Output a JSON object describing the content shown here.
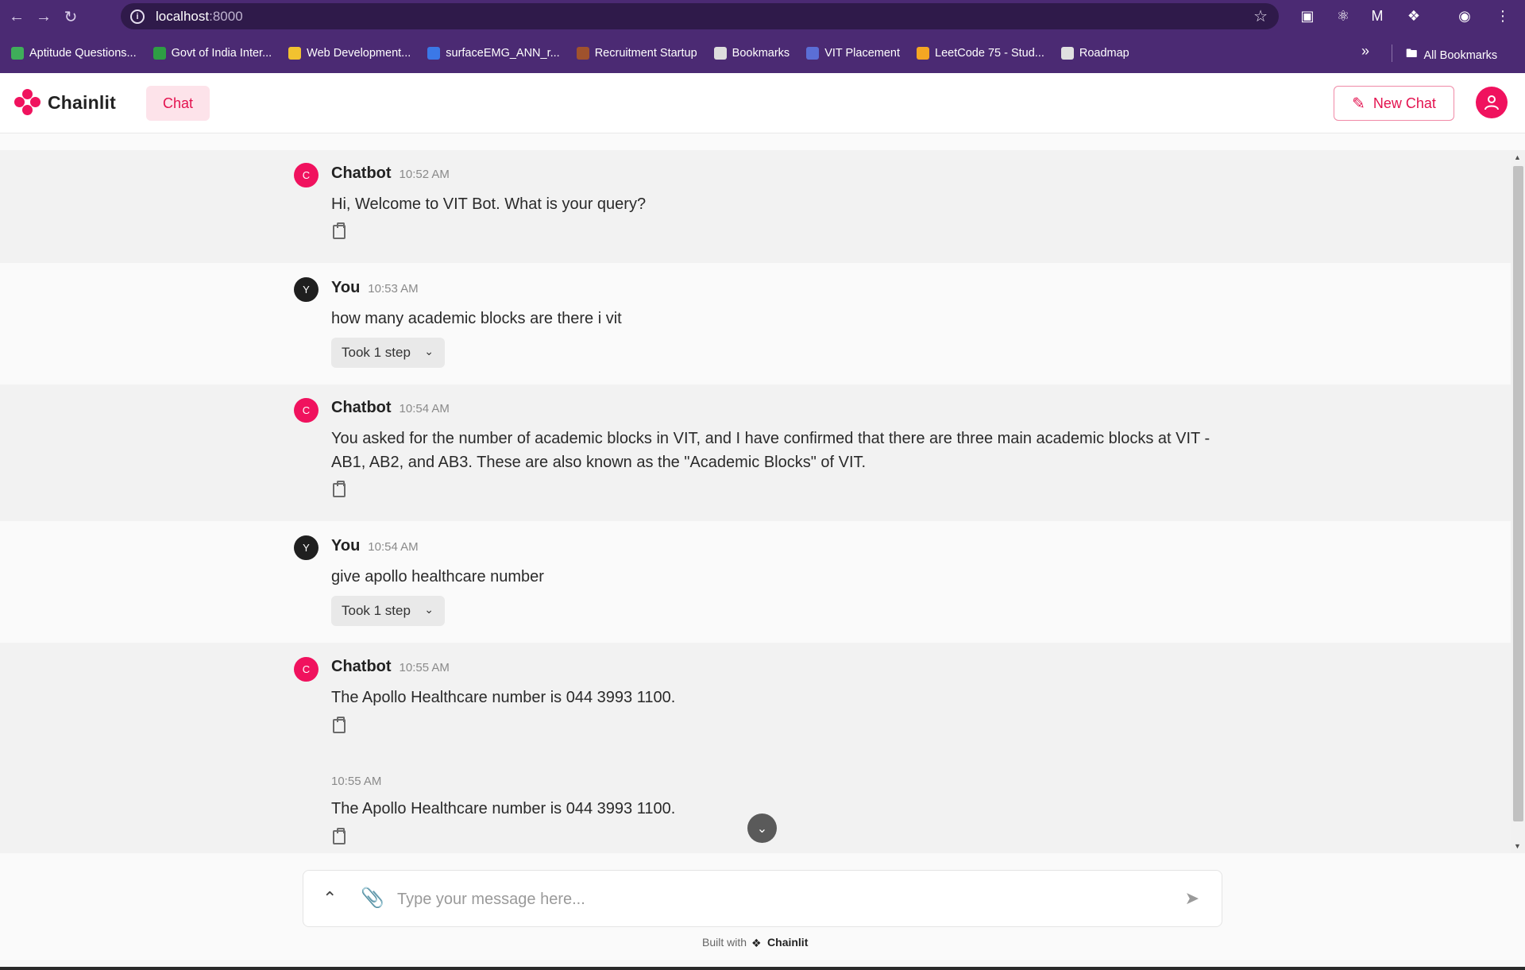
{
  "browser": {
    "url_host": "localhost",
    "url_port": ":8000",
    "bookmarks": [
      {
        "label": "Aptitude Questions...",
        "color": "#3fae5a"
      },
      {
        "label": "Govt of India Inter...",
        "color": "#2e9e44"
      },
      {
        "label": "Web Development...",
        "color": "#f2c230"
      },
      {
        "label": "surfaceEMG_ANN_r...",
        "color": "#3b78e7"
      },
      {
        "label": "Recruitment Startup",
        "color": "#a0522d"
      },
      {
        "label": "Bookmarks",
        "color": "#dddddd"
      },
      {
        "label": "VIT Placement",
        "color": "#5b6ed6"
      },
      {
        "label": "LeetCode 75 - Stud...",
        "color": "#f5a623"
      },
      {
        "label": "Roadmap",
        "color": "#e0e0e0"
      }
    ],
    "all_bookmarks": "All Bookmarks"
  },
  "app": {
    "brand": "Chainlit",
    "chat_tab": "Chat",
    "new_chat": "New Chat",
    "accent": "#f0125e"
  },
  "messages": [
    {
      "avatar": "C",
      "author": "Chatbot",
      "time": "10:52 AM",
      "text": "Hi, Welcome to VIT Bot. What is your query?"
    },
    {
      "avatar": "Y",
      "author": "You",
      "time": "10:53 AM",
      "text": "how many academic blocks are there i vit",
      "step": "Took 1 step"
    },
    {
      "avatar": "C",
      "author": "Chatbot",
      "time": "10:54 AM",
      "text": "You asked for the number of academic blocks in VIT, and I have confirmed that there are three main academic blocks at VIT - AB1, AB2, and AB3. These are also known as the \"Academic Blocks\" of VIT."
    },
    {
      "avatar": "Y",
      "author": "You",
      "time": "10:54 AM",
      "text": "give apollo healthcare number",
      "step": "Took 1 step"
    },
    {
      "avatar": "C",
      "author": "Chatbot",
      "time": "10:55 AM",
      "text": "The Apollo Healthcare number is 044 3993 1100."
    },
    {
      "time": "10:55 AM",
      "text": "The Apollo Healthcare number is 044 3993 1100."
    }
  ],
  "composer": {
    "placeholder": "Type your message here...",
    "built_with": "Built with",
    "built_brand": "Chainlit"
  }
}
